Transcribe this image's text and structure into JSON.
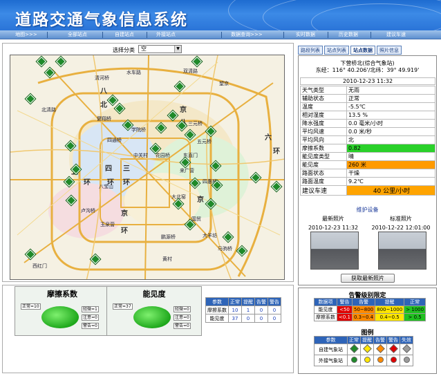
{
  "header": {
    "title": "道路交通气象信息系统"
  },
  "nav": {
    "items": [
      "地图>>>",
      "全部站点",
      "自建站点",
      "外接站点",
      "数据查询>>>",
      "实时数据",
      "历史数据",
      "建议车速"
    ]
  },
  "filter": {
    "label": "选择分类",
    "value": "空"
  },
  "map": {
    "labels": [
      "清河桥",
      "八达岭",
      "双清路",
      "水车路",
      "北清路",
      "健翔桥",
      "学院桥",
      "四通桥",
      "中关村",
      "花园桥",
      "八宝山",
      "卢沟桥",
      "玉泉营",
      "丰台",
      "宋家庄",
      "鹏源桥",
      "大羊坊",
      "亦庄",
      "四惠桥",
      "大北窑",
      "国贸",
      "东直门",
      "三元桥",
      "望京",
      "来广营",
      "五元桥",
      "四方桥",
      "马驹桥",
      "黄村",
      "西红门",
      "魏善庄",
      "肖村",
      "旧宫",
      "南苑",
      "太平桥",
      "北苑",
      "回龙观",
      "东三旗",
      "京承",
      "京通",
      "京沈",
      "京开",
      "京津塘",
      "京石"
    ],
    "district_labels": [
      "四",
      "环",
      "三",
      "环",
      "五",
      "环",
      "六",
      "环",
      "京",
      "八",
      "北",
      "西"
    ]
  },
  "gauges": [
    {
      "title": "摩擦系数",
      "tags": [
        "正常=10",
        "轻微=1",
        "注意=0",
        "警告=0"
      ]
    },
    {
      "title": "能见度",
      "tags": [
        "正常=37",
        "轻微=0",
        "注意=0",
        "警告=0"
      ]
    }
  ],
  "summary": {
    "headers": [
      "参数",
      "正常",
      "提醒",
      "告警",
      "警告"
    ],
    "rows": [
      [
        "摩擦系数",
        "10",
        "1",
        "0",
        "0"
      ],
      [
        "能见度",
        "37",
        "0",
        "0",
        "0"
      ]
    ]
  },
  "tabs": [
    "路段列表",
    "站点列表",
    "站点数据",
    "照片信息"
  ],
  "station": {
    "name": "下营桥北(综合气象站)",
    "coord": "东经：116° 40.206'/北纬：39° 49.919'",
    "time": "2010-12-23 11:32"
  },
  "params": [
    [
      "天气类型",
      "无雨"
    ],
    [
      "辅助状态",
      "正常"
    ],
    [
      "温度",
      "-5.5℃"
    ],
    [
      "相对湿度",
      "13.5 %"
    ],
    [
      "降水强度",
      "0.0 毫米/小时"
    ],
    [
      "平均风速",
      "0.0 米/秒"
    ],
    [
      "平均风向",
      "北"
    ],
    [
      "摩擦系数",
      "0.82"
    ],
    [
      "能见度类型",
      "晴"
    ],
    [
      "能见度",
      "260 米"
    ],
    [
      "路面状态",
      "干燥"
    ],
    [
      "路面温度",
      "9.2℃"
    ],
    [
      "建议车速",
      "40 公里/小时"
    ]
  ],
  "colors": {
    "friction_bg": "#2ad12a",
    "visibility_bg": "#ff9a00",
    "speed_bg": "#ffa400"
  },
  "maintenance": {
    "label": "维护设备"
  },
  "photos": {
    "latest_label": "最新照片",
    "standard_label": "标准照片",
    "latest_time": "2010-12-23 11:32",
    "standard_time": "2010-12-22 12:01:00",
    "button": "获取最新照片"
  },
  "alert": {
    "title": "告警级别限定",
    "headers": [
      "数据项",
      "警告",
      "告警",
      "提醒",
      "正常"
    ],
    "rows": [
      [
        "能见度",
        "<50",
        "50~800",
        "800~1000",
        "> 1000"
      ],
      [
        "摩擦系数",
        "<0.1",
        "0.3~0.4",
        "0.4~0.5",
        "> 0.5"
      ]
    ]
  },
  "legend": {
    "title": "图例",
    "headers": [
      "参数",
      "正常",
      "提醒",
      "告警",
      "警告",
      "失效"
    ],
    "rows": [
      "自建气象站",
      "外接气象站"
    ]
  }
}
